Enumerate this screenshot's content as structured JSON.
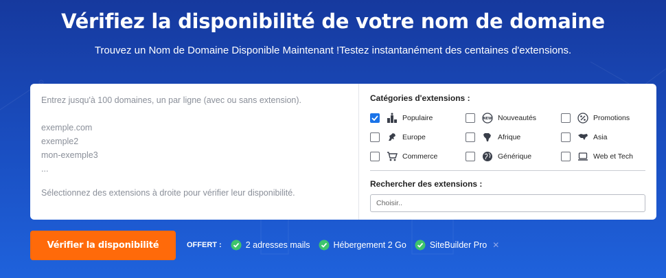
{
  "hero": {
    "title": "Vérifiez la disponibilité de votre nom de domaine",
    "subtitle": "Trouvez un Nom de Domaine Disponible Maintenant !Testez instantanément des centaines d'extensions."
  },
  "domains_input": {
    "lines": [
      "Entrez jusqu'à 100 domaines, un par ligne (avec ou sans extension).",
      "",
      "exemple.com",
      "exemple2",
      "mon-exemple3",
      "..."
    ],
    "hint": "Sélectionnez des extensions à droite pour vérifier leur disponibilité."
  },
  "categories": {
    "label": "Catégories d'extensions :",
    "items": [
      {
        "label": "Populaire",
        "icon": "podium-icon",
        "checked": true
      },
      {
        "label": "Nouveautés",
        "icon": "new-badge-icon",
        "checked": false
      },
      {
        "label": "Promotions",
        "icon": "percent-icon",
        "checked": false
      },
      {
        "label": "Europe",
        "icon": "europe-map-icon",
        "checked": false
      },
      {
        "label": "Afrique",
        "icon": "africa-map-icon",
        "checked": false
      },
      {
        "label": "Asia",
        "icon": "asia-map-icon",
        "checked": false
      },
      {
        "label": "Commerce",
        "icon": "cart-icon",
        "checked": false
      },
      {
        "label": "Générique",
        "icon": "globe-icon",
        "checked": false
      },
      {
        "label": "Web et Tech",
        "icon": "laptop-icon",
        "checked": false
      }
    ]
  },
  "extension_search": {
    "label": "Rechercher des extensions :",
    "placeholder": "Choisir.."
  },
  "check_button": {
    "label": "Vérifier la disponibilité"
  },
  "offers": {
    "label": "OFFERT :",
    "items": [
      "2 adresses mails",
      "Hébergement 2 Go",
      "SiteBuilder Pro"
    ]
  },
  "colors": {
    "accent_orange": "#ff6a0a",
    "check_green": "#3ec46d",
    "checkbox_blue": "#1a73e8"
  }
}
